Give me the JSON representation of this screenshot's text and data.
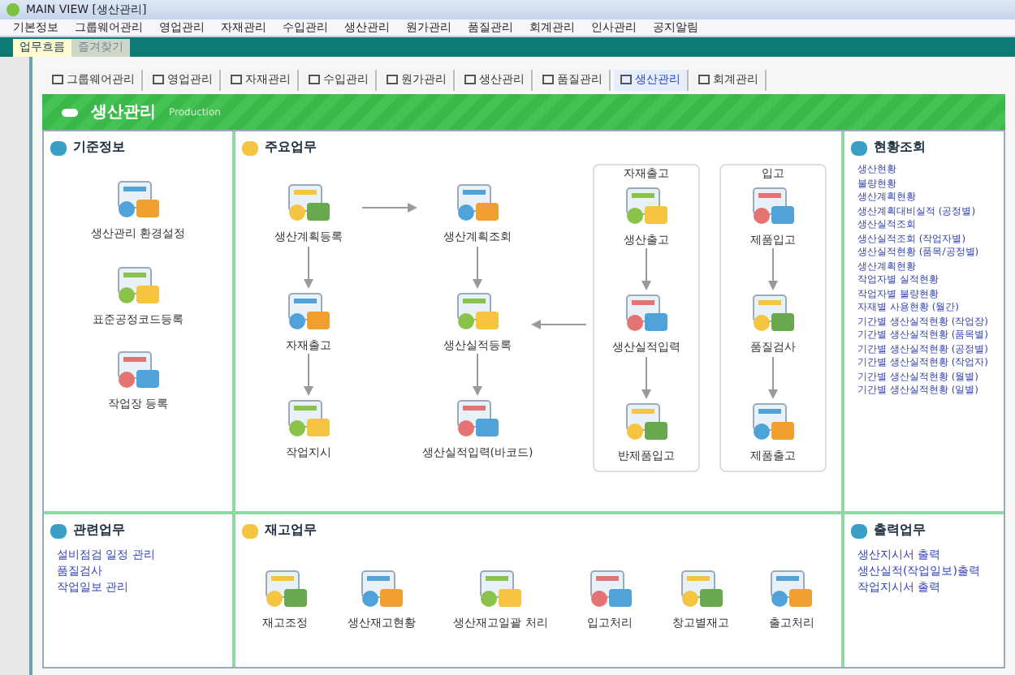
{
  "window": {
    "title": "MAIN VIEW [생산관리]"
  },
  "menu": [
    "기본정보",
    "그룹웨어관리",
    "영업관리",
    "자재관리",
    "수입관리",
    "생산관리",
    "원가관리",
    "품질관리",
    "회계관리",
    "인사관리",
    "공지알림"
  ],
  "top_tabs": [
    {
      "label": "업무흐름",
      "selected": true
    },
    {
      "label": "즐겨찾기",
      "selected": false
    }
  ],
  "module_tabs": [
    {
      "label": "그룹웨어관리",
      "selected": false
    },
    {
      "label": "영업관리",
      "selected": false
    },
    {
      "label": "자재관리",
      "selected": false
    },
    {
      "label": "수입관리",
      "selected": false
    },
    {
      "label": "원가관리",
      "selected": false
    },
    {
      "label": "생산관리",
      "selected": false
    },
    {
      "label": "품질관리",
      "selected": false
    },
    {
      "label": "생산관리",
      "selected": true
    },
    {
      "label": "회계관리",
      "selected": false
    }
  ],
  "header": {
    "title": "생산관리",
    "subtitle": "Production"
  },
  "basic_panel": {
    "title": "기준정보",
    "items": [
      "생산관리 환경설정",
      "표준공정코드등록",
      "작업장 등록"
    ]
  },
  "flow_panel": {
    "title": "주요업무",
    "columns": [
      {
        "nodes": [
          "생산계획등록",
          "자재출고",
          "작업지시"
        ]
      },
      {
        "nodes": [
          "생산계획조회",
          "생산실적등록",
          "생산실적입력(바코드)"
        ]
      },
      {
        "heading": "자재출고",
        "nodes": [
          "생산출고",
          "생산실적입력",
          "반제품입고"
        ]
      },
      {
        "heading": "입고",
        "nodes": [
          "제품입고",
          "품질검사",
          "제품출고"
        ]
      }
    ]
  },
  "report_panel": {
    "title": "현황조회",
    "links": [
      "생산현황",
      "불량현황",
      "생산계획현황",
      "생산계획대비실적 (공정별)",
      "생산실적조회",
      "생산실적조회 (작업자별)",
      "생산실적현황 (품목/공정별)",
      "생산계획현황",
      "작업자별 실적현황",
      "작업자별 불량현황",
      "자재별 사용현황 (월간)",
      "기간별 생산실적현황 (작업장)",
      "기간별 생산실적현황 (품목별)",
      "기간별 생산실적현황 (공정별)",
      "기간별 생산실적현황 (작업자)",
      "기간별 생산실적현황 (월별)",
      "기간별 생산실적현황 (일별)"
    ]
  },
  "related_panel": {
    "title": "관련업무",
    "links": [
      "설비점검 일정 관리",
      "품질검사",
      "작업일보 관리"
    ]
  },
  "sub_panel": {
    "title": "재고업무",
    "items": [
      "재고조정",
      "생산재고현황",
      "생산재고일괄 처리",
      "입고처리",
      "창고별재고",
      "출고처리"
    ]
  },
  "print_panel": {
    "title": "출력업무",
    "links": [
      "생산지시서 출력",
      "생산실적(작업일보)출력",
      "작업지시서 출력"
    ]
  }
}
